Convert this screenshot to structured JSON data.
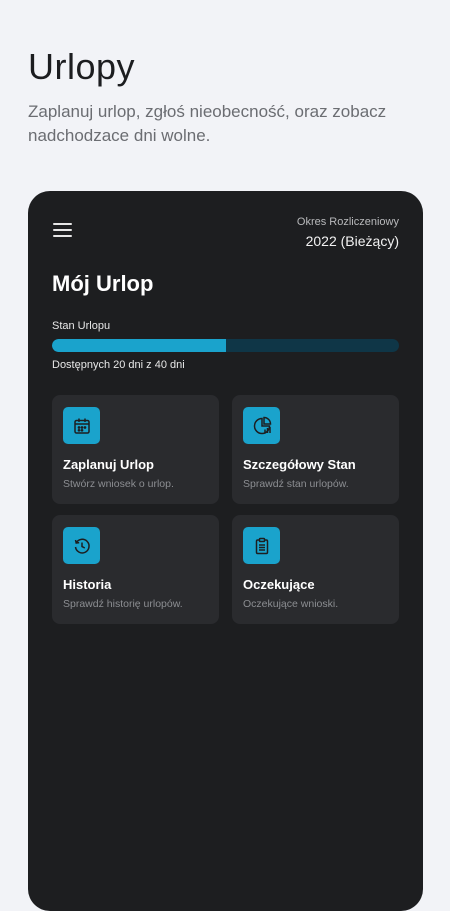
{
  "header": {
    "title": "Urlopy",
    "subtitle": "Zaplanuj urlop, zgłoś nieobecność, oraz zobacz nadchodzace dni wolne."
  },
  "app": {
    "period_label": "Okres Rozliczeniowy",
    "period_value": "2022 (Bieżący)",
    "title": "Mój Urlop",
    "balance_label": "Stan Urlopu",
    "balance_text": "Dostępnych 20 dni z 40 dni",
    "balance_fraction": 0.5,
    "accent_color": "#1aa3cc",
    "tiles": [
      {
        "title": "Zaplanuj Urlop",
        "desc": "Stwórz wniosek o urlop.",
        "icon": "calendar-icon"
      },
      {
        "title": "Szczegółowy Stan",
        "desc": "Sprawdź stan urlopów.",
        "icon": "pie-chart-icon"
      },
      {
        "title": "Historia",
        "desc": "Sprawdź historię urlopów.",
        "icon": "history-icon"
      },
      {
        "title": "Oczekujące",
        "desc": "Oczekujące wnioski.",
        "icon": "clipboard-icon"
      }
    ]
  }
}
